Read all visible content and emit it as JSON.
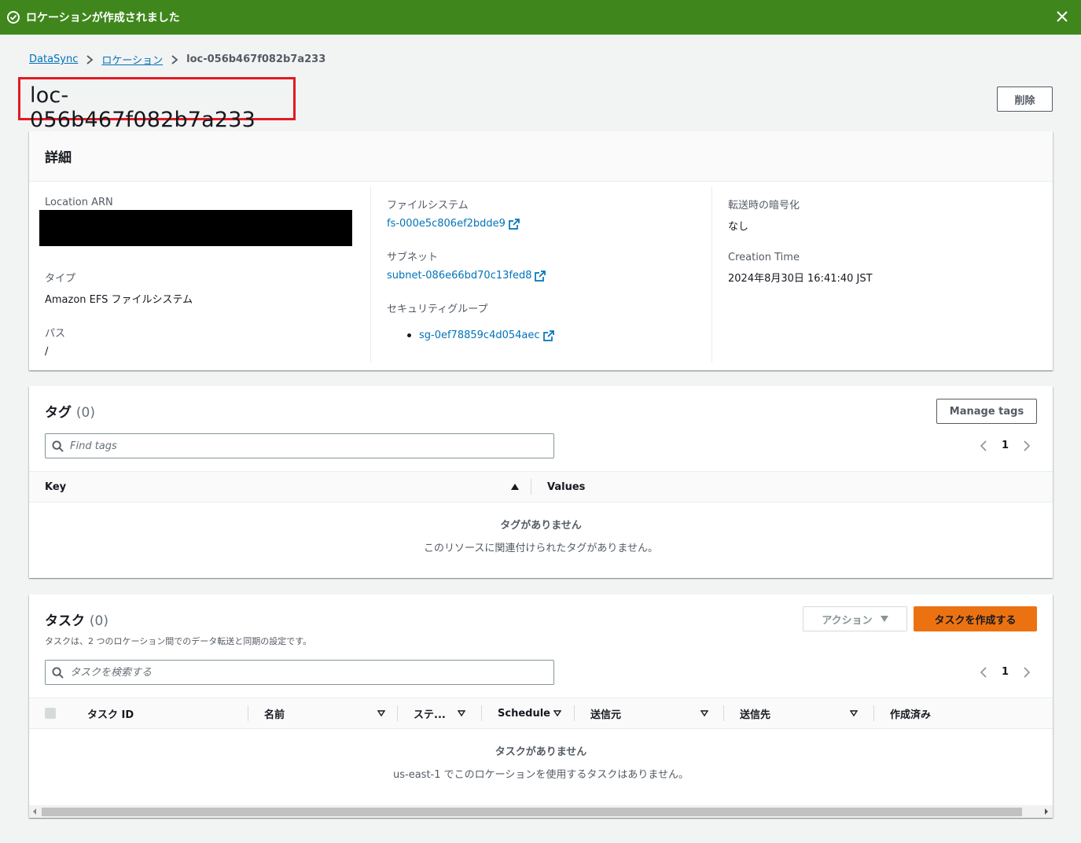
{
  "flash": {
    "message": "ロケーションが作成されました"
  },
  "breadcrumb": {
    "items": [
      "DataSync",
      "ロケーション"
    ],
    "current": "loc-056b467f082b7a233"
  },
  "page": {
    "title": "loc-056b467f082b7a233",
    "delete_label": "削除"
  },
  "details": {
    "heading": "詳細",
    "location_arn_label": "Location ARN",
    "type_label": "タイプ",
    "type_value": "Amazon EFS ファイルシステム",
    "path_label": "パス",
    "path_value": "/",
    "filesystem_label": "ファイルシステム",
    "filesystem_value": "fs-000e5c806ef2bdde9",
    "subnet_label": "サブネット",
    "subnet_value": "subnet-086e66bd70c13fed8",
    "sg_label": "セキュリティグループ",
    "sg_values": [
      "sg-0ef78859c4d054aec"
    ],
    "encryption_label": "転送時の暗号化",
    "encryption_value": "なし",
    "creation_label": "Creation Time",
    "creation_value": "2024年8月30日 16:41:40 JST"
  },
  "tags": {
    "title": "タグ",
    "count": "(0)",
    "manage_label": "Manage tags",
    "search_placeholder": "Find tags",
    "page": "1",
    "columns": [
      "Key",
      "Values"
    ],
    "empty_title": "タグがありません",
    "empty_desc": "このリソースに関連付けられたタグがありません。"
  },
  "tasks": {
    "title": "タスク",
    "count": "(0)",
    "description": "タスクは、2 つのロケーション間でのデータ転送と同期の設定です。",
    "actions_label": "アクション",
    "create_label": "タスクを作成する",
    "search_placeholder": "タスクを検索する",
    "page": "1",
    "columns": [
      "タスク ID",
      "名前",
      "ステ...",
      "Schedule",
      "送信元",
      "送信先",
      "作成済み"
    ],
    "empty_title": "タスクがありません",
    "empty_desc": "us-east-1 でこのロケーションを使用するタスクはありません。"
  },
  "colors": {
    "flash": "#3f871d",
    "link": "#0073bb",
    "primary": "#ec7211",
    "highlight": "#e01b24"
  }
}
